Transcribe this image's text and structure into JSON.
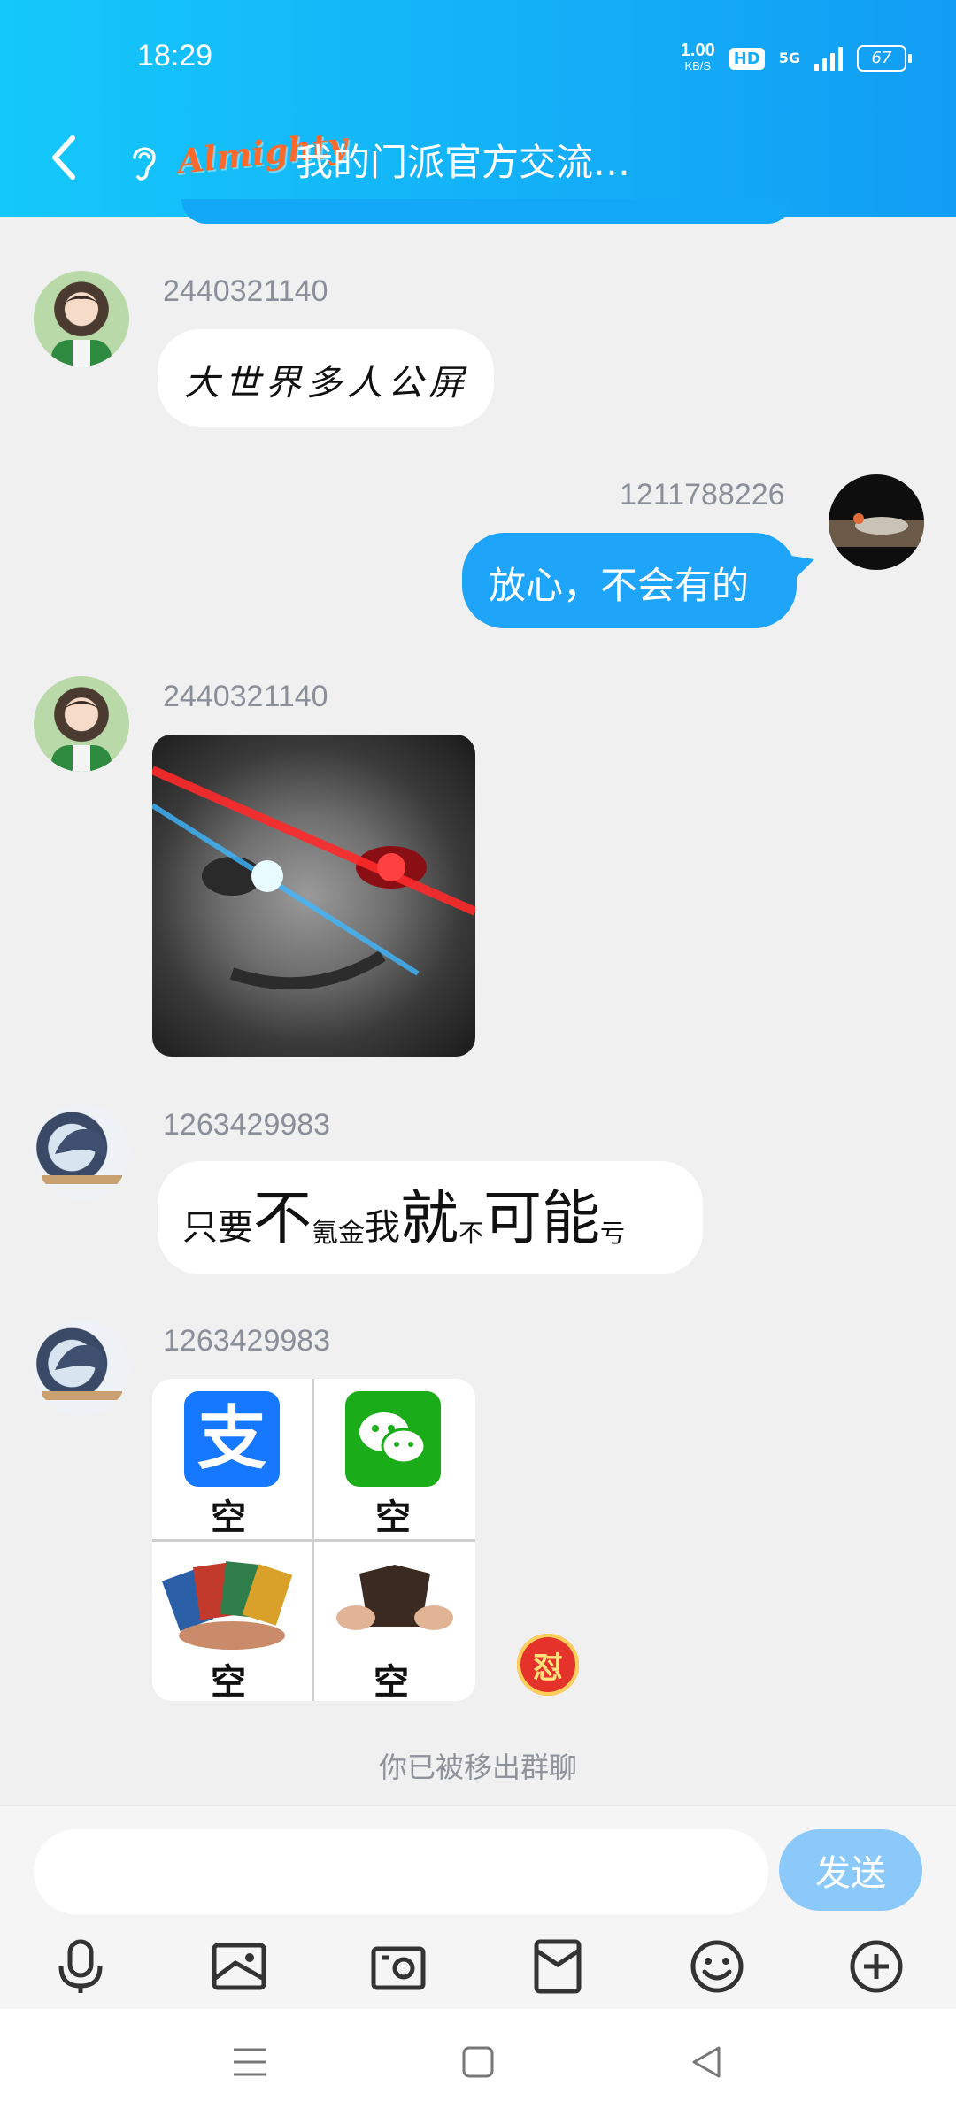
{
  "status_bar": {
    "time": "18:29",
    "net_speed": "1.00",
    "net_unit": "KB/S",
    "hd": "HD",
    "network": "5G",
    "battery": "67"
  },
  "header": {
    "title": "我的门派官方交流…",
    "logo_text": "Almighty"
  },
  "messages": [
    {
      "sender": "2440321140",
      "text": "大世界多人公屏"
    },
    {
      "sender": "1211788226",
      "text": "放心，不会有的"
    },
    {
      "sender": "2440321140",
      "image": "sticker-glowing-eye-face"
    },
    {
      "sender": "1263429983",
      "parts": [
        "只要",
        "不",
        "氪金",
        "我",
        "就",
        "不",
        "可能",
        "亏"
      ]
    },
    {
      "sender": "1263429983",
      "sticker_labels": [
        "空",
        "空",
        "空",
        "空"
      ],
      "reaction": "怼"
    }
  ],
  "system_notice": "你已被移出群聊",
  "input": {
    "placeholder": "",
    "value": ""
  },
  "send_label": "发送",
  "colors": {
    "header": "#13aef7",
    "bubble_out": "#1ea4f8",
    "send_disabled": "#8cc9fb"
  }
}
